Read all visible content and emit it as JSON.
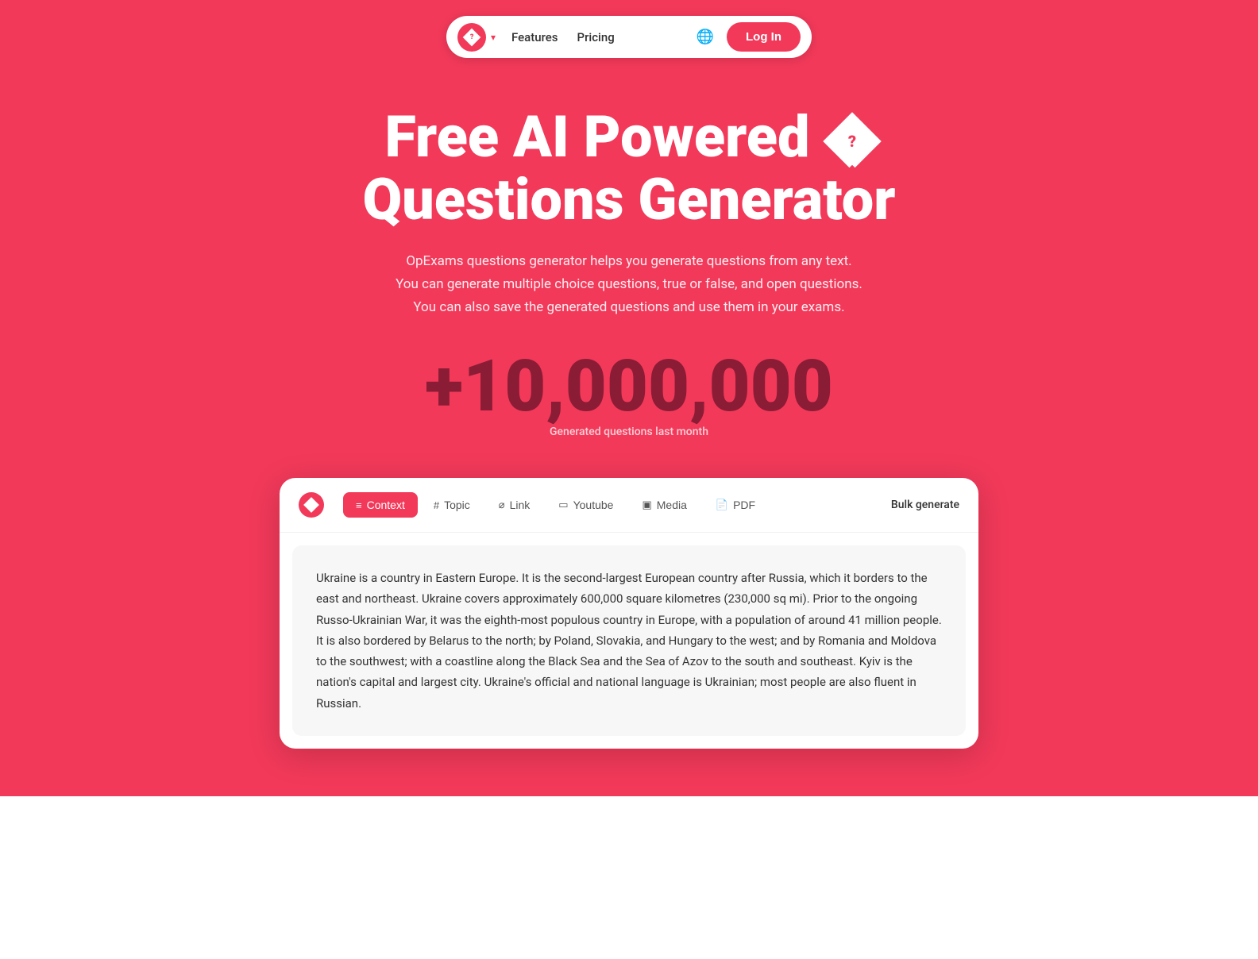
{
  "navbar": {
    "logo_symbol": "?",
    "features_label": "Features",
    "pricing_label": "Pricing",
    "login_label": "Log In"
  },
  "hero": {
    "title_line1": "Free AI Powered",
    "title_line2": "Questions Generator",
    "subtitle_line1": "OpExams questions generator helps you generate questions from any text.",
    "subtitle_line2": "You can generate multiple choice questions, true or false, and open questions.",
    "subtitle_line3": "You can also save the generated questions and use them in your exams.",
    "counter_number": "+10,000,000",
    "counter_label": "Generated questions last month"
  },
  "generator": {
    "tabs": [
      {
        "id": "context",
        "label": "Context",
        "icon": "≡",
        "active": true
      },
      {
        "id": "topic",
        "label": "Topic",
        "icon": "#",
        "active": false
      },
      {
        "id": "link",
        "label": "Link",
        "icon": "🔗",
        "active": false
      },
      {
        "id": "youtube",
        "label": "Youtube",
        "icon": "▭",
        "active": false
      },
      {
        "id": "media",
        "label": "Media",
        "icon": "▣",
        "active": false
      },
      {
        "id": "pdf",
        "label": "PDF",
        "icon": "📄",
        "active": false
      }
    ],
    "bulk_generate_label": "Bulk generate",
    "content_text": "Ukraine is a country in Eastern Europe. It is the second-largest European country after Russia, which it borders to the east and northeast. Ukraine covers approximately 600,000 square kilometres (230,000 sq mi). Prior to the ongoing Russo-Ukrainian War, it was the eighth-most populous country in Europe, with a population of around 41 million people. It is also bordered by Belarus to the north; by Poland, Slovakia, and Hungary to the west; and by Romania and Moldova to the southwest; with a coastline along the Black Sea and the Sea of Azov to the south and southeast. Kyiv is the nation's capital and largest city. Ukraine's official and national language is Ukrainian; most people are also fluent in Russian."
  },
  "colors": {
    "primary": "#f2395a",
    "dark_red": "#8b1c35"
  }
}
